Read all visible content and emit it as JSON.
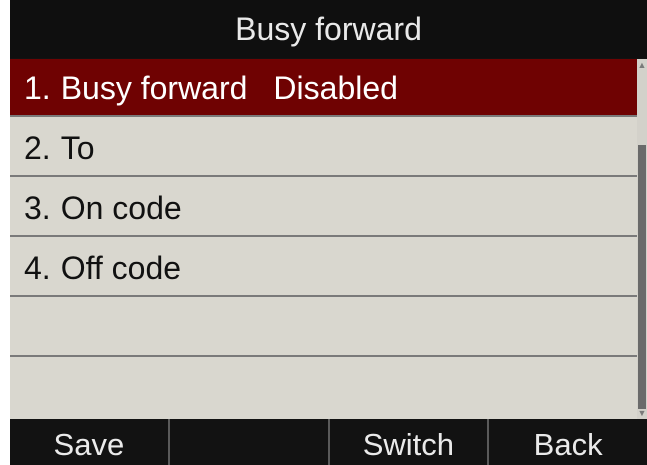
{
  "header": {
    "title": "Busy forward"
  },
  "menu": {
    "items": [
      {
        "number": "1.",
        "label": "Busy forward",
        "value": "Disabled",
        "selected": true
      },
      {
        "number": "2.",
        "label": "To",
        "value": ""
      },
      {
        "number": "3.",
        "label": "On code",
        "value": ""
      },
      {
        "number": "4.",
        "label": "Off code",
        "value": ""
      }
    ]
  },
  "softkeys": {
    "key1": "Save",
    "key2": "",
    "key3": "Switch",
    "key4": "Back"
  },
  "colors": {
    "selected_row": "#6f0202",
    "list_background": "#d9d7cf",
    "bar_background": "#121212"
  },
  "icons": {
    "scroll_up": "scroll-up-arrow-icon",
    "scroll_down": "scroll-down-arrow-icon"
  }
}
